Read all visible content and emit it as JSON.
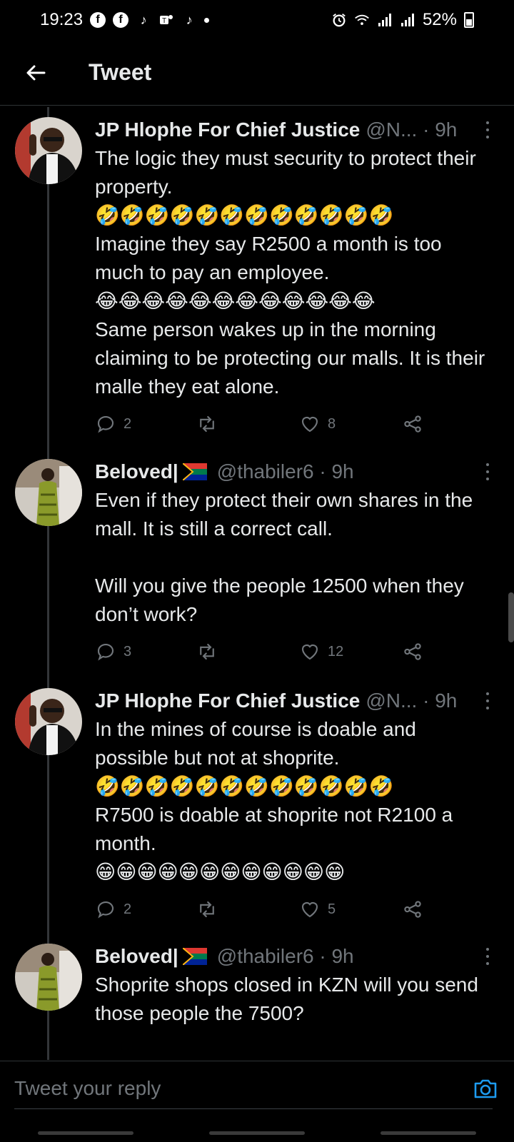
{
  "status_bar": {
    "time": "19:23",
    "battery": "52%",
    "left_icons": [
      "facebook-icon",
      "facebook-icon",
      "tiktok-icon",
      "teams-icon",
      "tiktok-icon",
      "dot"
    ],
    "right_icons": [
      "alarm-icon",
      "wifi-icon",
      "signal-icon",
      "signal-icon",
      "battery-icon"
    ]
  },
  "header": {
    "title": "Tweet"
  },
  "tweets": [
    {
      "name": "JP Hlophe For Chief Justice",
      "handle": "@N... · 9h",
      "text": "The logic they must security to protect their property.\n🤣🤣🤣🤣🤣🤣🤣🤣🤣🤣🤣🤣\nImagine they say R2500 a month is too much to pay an employee.\n😂😂😂😂😂😂😂😂😂😂😂😂\nSame person wakes up in the morning claiming to be protecting our malls. It is their malle they eat alone.",
      "replies": "2",
      "retweets": "",
      "likes": "8"
    },
    {
      "name": "Beloved|",
      "flag": "South Africa",
      "handle": "@thabiler6 · 9h",
      "text": "Even if they protect their own shares in the mall. It is still a correct call.\n\nWill you give the people 12500 when they don’t work?",
      "replies": "3",
      "retweets": "",
      "likes": "12"
    },
    {
      "name": "JP Hlophe For Chief Justice",
      "handle": "@N... · 9h",
      "text": "In the mines of course is doable and possible but not at shoprite.\n🤣🤣🤣🤣🤣🤣🤣🤣🤣🤣🤣🤣\nR7500 is doable at shoprite not R2100 a month.\n😁😁😁😁😁😁😁😁😁😁😁😁",
      "replies": "2",
      "retweets": "",
      "likes": "5"
    },
    {
      "name": "Beloved|",
      "flag": "South Africa",
      "handle": "@thabiler6 · 9h",
      "text": "Shoprite shops closed in KZN will you send those people the 7500?",
      "replies": "",
      "retweets": "",
      "likes": ""
    }
  ],
  "reply": {
    "placeholder": "Tweet your reply"
  },
  "colors": {
    "background": "#000000",
    "text": "#e7e9ea",
    "muted": "#71767b",
    "accent": "#1d9bf0"
  }
}
